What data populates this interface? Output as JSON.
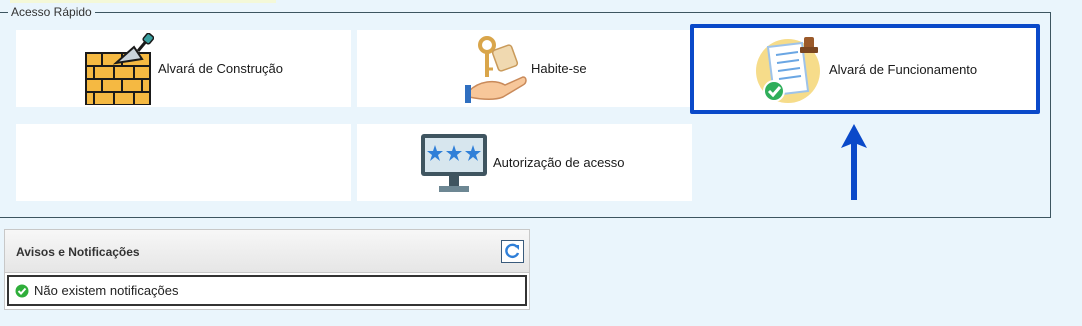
{
  "quick_access": {
    "legend": "Acesso Rápido",
    "cards": [
      {
        "label": "Alvará de Construção",
        "icon": "brick-wall-trowel-icon"
      },
      {
        "label": "Habite-se",
        "icon": "hand-keys-icon"
      },
      {
        "label": "Alvará de Funcionamento",
        "icon": "license-document-stamp-icon"
      },
      {
        "label": "",
        "icon": ""
      },
      {
        "label": "Autorização de acesso",
        "icon": "monitor-password-icon"
      }
    ]
  },
  "notifications": {
    "title": "Avisos e Notificações",
    "refresh_icon": "refresh-icon",
    "message": "Não existem notificações",
    "status_icon": "check-circle-icon"
  },
  "colors": {
    "highlight": "#0a49c9",
    "background": "#eaf5fc"
  }
}
